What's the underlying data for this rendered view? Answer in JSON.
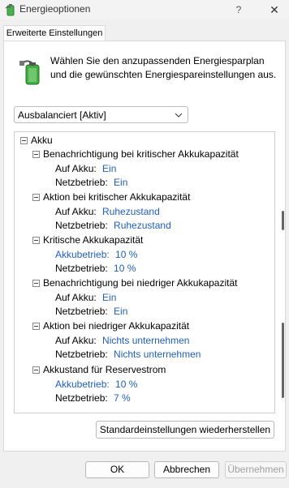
{
  "window": {
    "title": "Energieoptionen",
    "help": "?",
    "close": "✕"
  },
  "tab": {
    "label": "Erweiterte Einstellungen"
  },
  "intro": "Wählen Sie den anzupassenden Energiesparplan und die gewünschten Energiespareinstellungen aus.",
  "plan": {
    "selected": "Ausbalanciert [Aktiv]"
  },
  "tree": {
    "root": "Akku",
    "groups": [
      {
        "label": "Benachrichtigung bei kritischer Akkukapazität",
        "rows": [
          {
            "label": "Auf Akku:",
            "value": "Ein"
          },
          {
            "label": "Netzbetrieb:",
            "value": "Ein"
          }
        ]
      },
      {
        "label": "Aktion bei kritischer Akkukapazität",
        "rows": [
          {
            "label": "Auf Akku:",
            "value": "Ruhezustand"
          },
          {
            "label": "Netzbetrieb:",
            "value": "Ruhezustand"
          }
        ]
      },
      {
        "label": "Kritische Akkukapazität",
        "rows": [
          {
            "label": "Akkubetrieb:",
            "value": "10 %"
          },
          {
            "label": "Netzbetrieb:",
            "value": "10 %"
          }
        ]
      },
      {
        "label": "Benachrichtigung bei niedriger Akkukapazität",
        "rows": [
          {
            "label": "Auf Akku:",
            "value": "Ein"
          },
          {
            "label": "Netzbetrieb:",
            "value": "Ein"
          }
        ]
      },
      {
        "label": "Aktion bei niedriger Akkukapazität",
        "rows": [
          {
            "label": "Auf Akku:",
            "value": "Nichts unternehmen"
          },
          {
            "label": "Netzbetrieb:",
            "value": "Nichts unternehmen"
          }
        ]
      },
      {
        "label": "Akkustand für Reservestrom",
        "rows": [
          {
            "label": "Akkubetrieb:",
            "value": "10 %"
          },
          {
            "label": "Netzbetrieb:",
            "value": "7 %"
          }
        ]
      }
    ]
  },
  "buttons": {
    "restore": "Standardeinstellungen wiederherstellen",
    "ok": "OK",
    "cancel": "Abbrechen",
    "apply": "Übernehmen"
  }
}
